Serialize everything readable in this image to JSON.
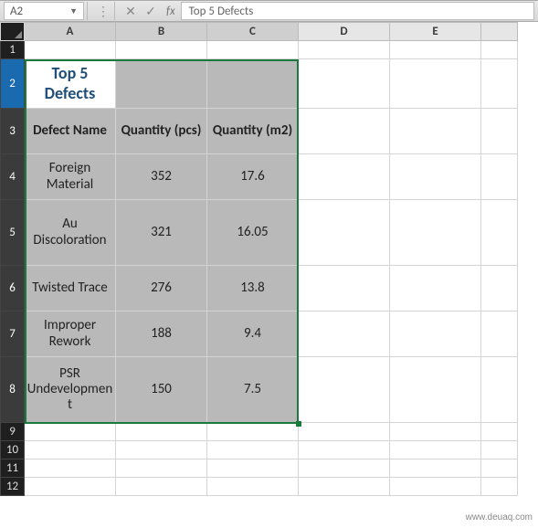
{
  "formula_bar": {
    "cell_ref": "A2",
    "fx_label": "fx",
    "content": "Top 5 Defects"
  },
  "columns": [
    "A",
    "B",
    "C",
    "D",
    "E"
  ],
  "row_numbers": [
    1,
    2,
    3,
    4,
    5,
    6,
    7,
    8,
    9,
    10,
    11,
    12
  ],
  "title": "Top 5 Defects",
  "headers": {
    "col_a": "Defect Name",
    "col_b": "Quantity (pcs)",
    "col_c": "Quantity (m2)"
  },
  "rows": [
    {
      "name": "Foreign Material",
      "pcs": "352",
      "m2": "17.6"
    },
    {
      "name": "Au Discoloration",
      "pcs": "321",
      "m2": "16.05"
    },
    {
      "name": "Twisted Trace",
      "pcs": "276",
      "m2": "13.8"
    },
    {
      "name": "Improper Rework",
      "pcs": "188",
      "m2": "9.4"
    },
    {
      "name": "PSR Undevelopment",
      "pcs": "150",
      "m2": "7.5"
    }
  ],
  "selection": {
    "range": "A2:C8",
    "active": "A2"
  },
  "watermark": "www.deuaq.com",
  "chart_data": {
    "type": "table",
    "title": "Top 5 Defects",
    "columns": [
      "Defect Name",
      "Quantity (pcs)",
      "Quantity (m2)"
    ],
    "data": [
      [
        "Foreign Material",
        352,
        17.6
      ],
      [
        "Au Discoloration",
        321,
        16.05
      ],
      [
        "Twisted Trace",
        276,
        13.8
      ],
      [
        "Improper Rework",
        188,
        9.4
      ],
      [
        "PSR Undevelopment",
        150,
        7.5
      ]
    ]
  }
}
